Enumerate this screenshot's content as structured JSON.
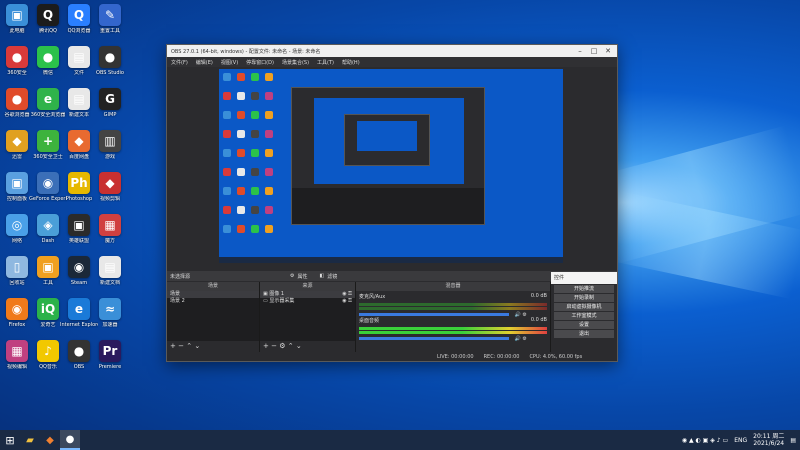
{
  "desktop": {
    "icons": [
      {
        "label": "此电脑",
        "glyph": "▣",
        "color": "#3a8fd8"
      },
      {
        "label": "腾讯QQ",
        "glyph": "Q",
        "color": "#1c1c1c"
      },
      {
        "label": "QQ浏览器",
        "glyph": "Q",
        "color": "#2a7fff"
      },
      {
        "label": "重置工具",
        "glyph": "✎",
        "color": "#3366cc"
      },
      {
        "label": "360安全",
        "glyph": "●",
        "color": "#d93a3a"
      },
      {
        "label": "微信",
        "glyph": "●",
        "color": "#2bc24a"
      },
      {
        "label": "文件",
        "glyph": "▤",
        "color": "#e8e8e8"
      },
      {
        "label": "OBS Studio",
        "glyph": "●",
        "color": "#333"
      },
      {
        "label": "谷歌浏览器",
        "glyph": "●",
        "color": "#e04b2a"
      },
      {
        "label": "360安全浏览器",
        "glyph": "e",
        "color": "#2fb34a"
      },
      {
        "label": "新建文本",
        "glyph": "▤",
        "color": "#e8e8e8"
      },
      {
        "label": "GIMP",
        "glyph": "G",
        "color": "#222"
      },
      {
        "label": "迅雷",
        "glyph": "◆",
        "color": "#e0a020"
      },
      {
        "label": "360安全卫士",
        "glyph": "+",
        "color": "#3db33d"
      },
      {
        "label": "百度网盘",
        "glyph": "◆",
        "color": "#e86a30"
      },
      {
        "label": "游戏",
        "glyph": "▥",
        "color": "#444"
      },
      {
        "label": "控制面板",
        "glyph": "▣",
        "color": "#5aa0e0"
      },
      {
        "label": "GeForce Experience",
        "glyph": "◉",
        "color": "#3b6fb8"
      },
      {
        "label": "Photoshop",
        "glyph": "Ph",
        "color": "#e6b800"
      },
      {
        "label": "视频剪辑",
        "glyph": "◆",
        "color": "#c83030"
      },
      {
        "label": "网络",
        "glyph": "◎",
        "color": "#4aa0e8"
      },
      {
        "label": "Dash",
        "glyph": "◈",
        "color": "#4a9fd8"
      },
      {
        "label": "英雄联盟",
        "glyph": "▣",
        "color": "#2b2b2b"
      },
      {
        "label": "魔方",
        "glyph": "▦",
        "color": "#d04040"
      },
      {
        "label": "回收站",
        "glyph": "▯",
        "color": "#8fb8e0"
      },
      {
        "label": "工具",
        "glyph": "▣",
        "color": "#f0a020"
      },
      {
        "label": "Steam",
        "glyph": "◉",
        "color": "#1b2838"
      },
      {
        "label": "新建文档",
        "glyph": "▤",
        "color": "#e8e8e8"
      },
      {
        "label": "Firefox",
        "glyph": "◉",
        "color": "#f07a1a"
      },
      {
        "label": "爱奇艺",
        "glyph": "iQ",
        "color": "#2bb24a"
      },
      {
        "label": "Internet Explorer",
        "glyph": "e",
        "color": "#1a7ad8"
      },
      {
        "label": "加速器",
        "glyph": "≈",
        "color": "#3a8fd8"
      },
      {
        "label": "视频编辑",
        "glyph": "▦",
        "color": "#c04080"
      },
      {
        "label": "QQ音乐",
        "glyph": "♪",
        "color": "#f2c800"
      },
      {
        "label": "OBS",
        "glyph": "●",
        "color": "#333"
      },
      {
        "label": "Premiere",
        "glyph": "Pr",
        "color": "#2a1a5e"
      }
    ]
  },
  "obs": {
    "title": "OBS 27.0.1 (64-bit, windows) - 配置文件: 未命名 - 场景: 未命名",
    "menu": [
      "文件(F)",
      "编辑(E)",
      "视图(V)",
      "停靠窗口(D)",
      "场景集合(S)",
      "工具(T)",
      "帮助(H)"
    ],
    "transbar_label": "未选择源",
    "prop_btn": "属性",
    "filter_btn": "滤镜",
    "docks": {
      "scenes": {
        "header": "场景",
        "items": [
          "场景",
          "场景 2"
        ]
      },
      "sources": {
        "header": "来源",
        "items": [
          "图像 1",
          "显示器采集"
        ]
      },
      "mixer": {
        "header": "混音器",
        "tracks": [
          {
            "name": "麦克风/Aux",
            "db": "0.0 dB"
          },
          {
            "name": "桌面音频",
            "db": "0.0 dB"
          }
        ]
      },
      "controls": {
        "header": "控件",
        "buttons": [
          "开始推流",
          "开始录制",
          "启动虚拟摄像机",
          "工作室模式",
          "设置",
          "退出"
        ]
      }
    },
    "status": {
      "live": "LIVE: 00:00:00",
      "rec": "REC: 00:00:00",
      "cpu": "CPU: 4.0%, 60.00 fps"
    }
  },
  "taskbar": {
    "time": "20:11 周二",
    "date": "2021/6/24",
    "lang": "ENG"
  }
}
